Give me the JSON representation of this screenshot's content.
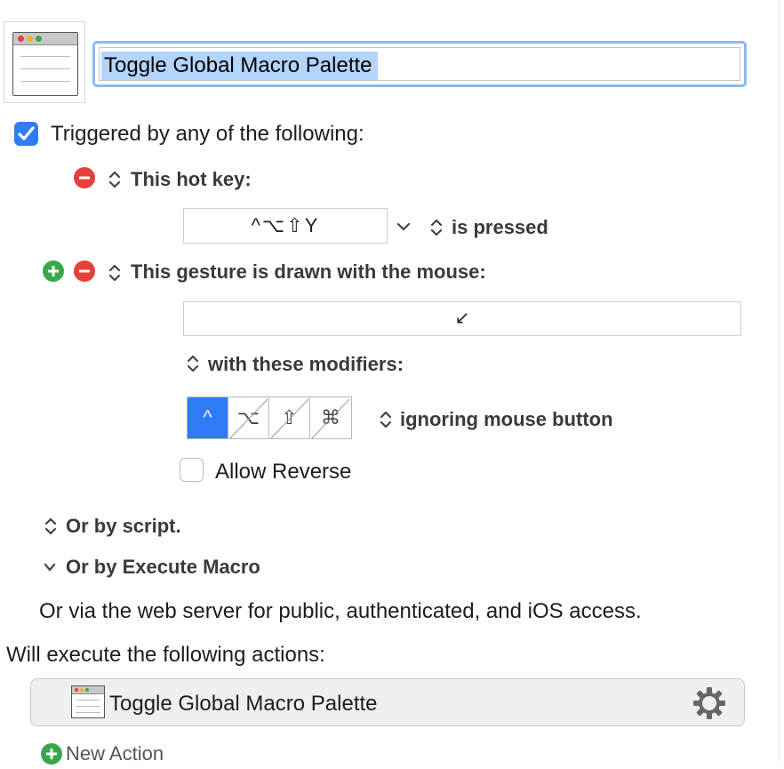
{
  "macro": {
    "title": "Toggle Global Macro Palette"
  },
  "triggers": {
    "header": "Triggered by any of the following:",
    "hotkey": {
      "label": "This hot key:",
      "keys": "^⌥⇧Y",
      "state": "is pressed"
    },
    "gesture": {
      "label": "This gesture is drawn with the mouse:",
      "gesture_symbol": "↙",
      "modifiers_label": "with these modifiers:",
      "modifiers": [
        "^",
        "⌥",
        "⇧",
        "⌘"
      ],
      "modifiers_active": [
        "^"
      ],
      "mouse_button": "ignoring mouse button",
      "allow_reverse": "Allow Reverse"
    },
    "script": "Or by script.",
    "execute_macro": "Or by Execute Macro",
    "web_server": "Or via the web server for public, authenticated, and iOS access."
  },
  "actions": {
    "header": "Will execute the following actions:",
    "items": [
      {
        "label": "Toggle Global Macro Palette"
      }
    ],
    "new_action": "New Action"
  },
  "colors": {
    "accent": "#2e7cf6",
    "selection": "#b3d4fd",
    "remove": "#e5403a",
    "add": "#3aa84a"
  }
}
